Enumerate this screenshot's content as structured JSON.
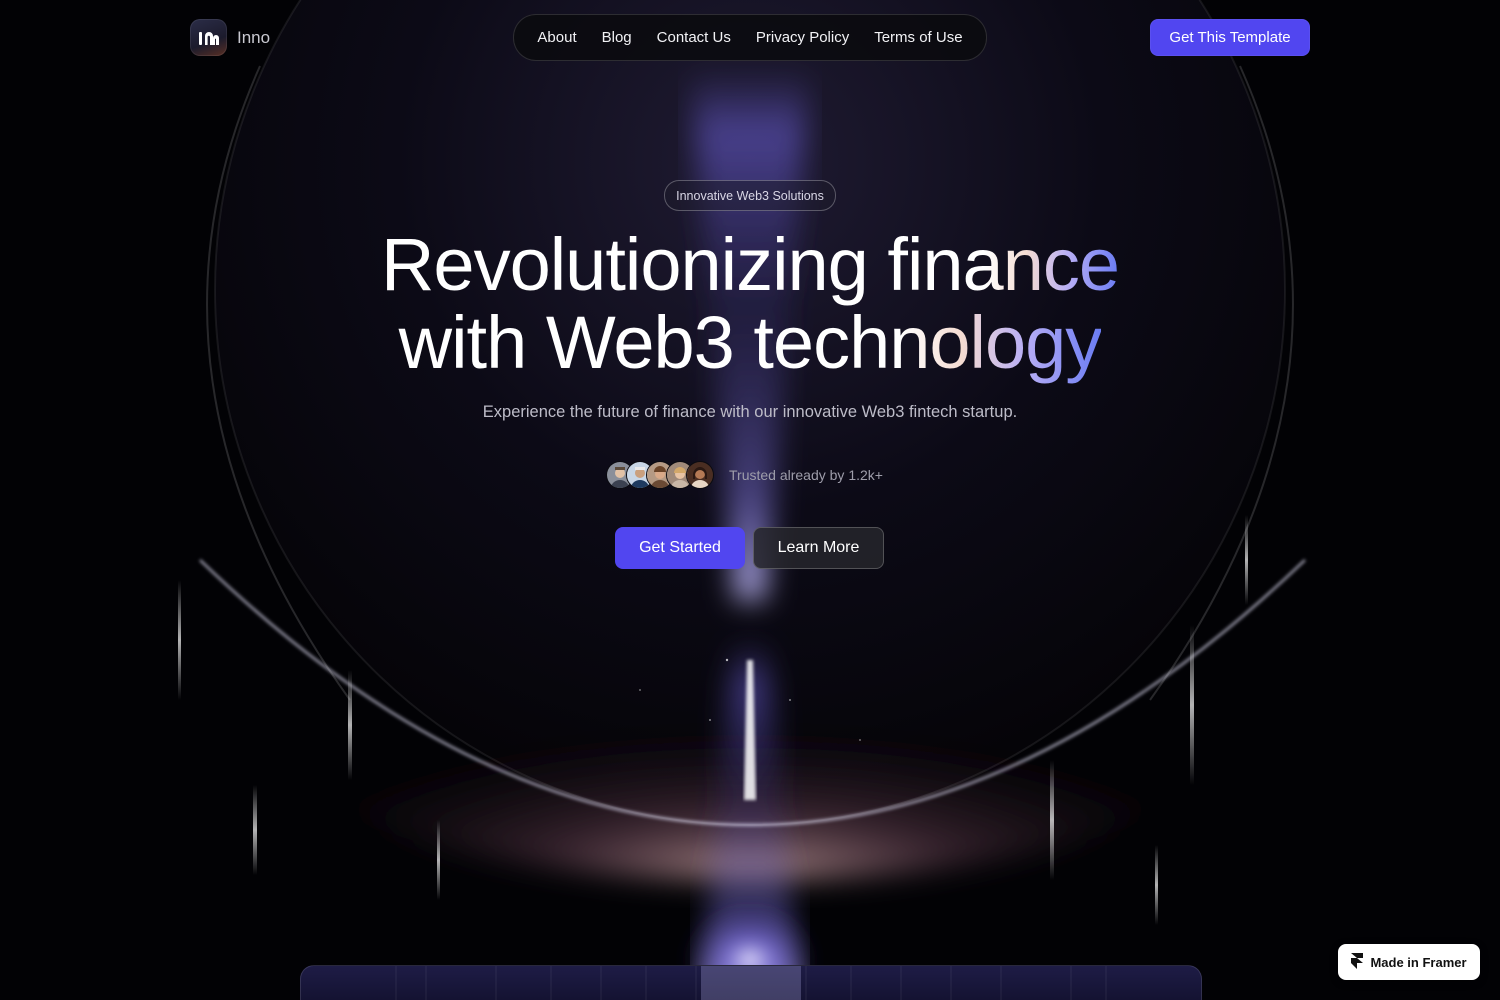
{
  "brand": {
    "name": "Inno",
    "logo_glyph": "ın"
  },
  "nav": {
    "items": [
      "About",
      "Blog",
      "Contact Us",
      "Privacy Policy",
      "Terms of Use"
    ]
  },
  "header": {
    "cta_label": "Get This Template"
  },
  "hero": {
    "badge": "Innovative Web3 Solutions",
    "headline_line1_plain": "Revolutionizing ",
    "headline_line1_grad": "finance",
    "headline_line2_plain": "with Web3 ",
    "headline_line2_grad": "technology",
    "subtitle": "Experience the future of finance with our innovative Web3 fintech startup.",
    "trusted_text": "Trusted already by 1.2k+",
    "avatar_count": 5,
    "primary_button": "Get Started",
    "secondary_button": "Learn More"
  },
  "badge_framer": {
    "label": "Made in Framer",
    "icon": "framer-icon"
  },
  "colors": {
    "accent": "#5146f0",
    "background": "#020205",
    "gradient_end": "#6a7cf3"
  }
}
